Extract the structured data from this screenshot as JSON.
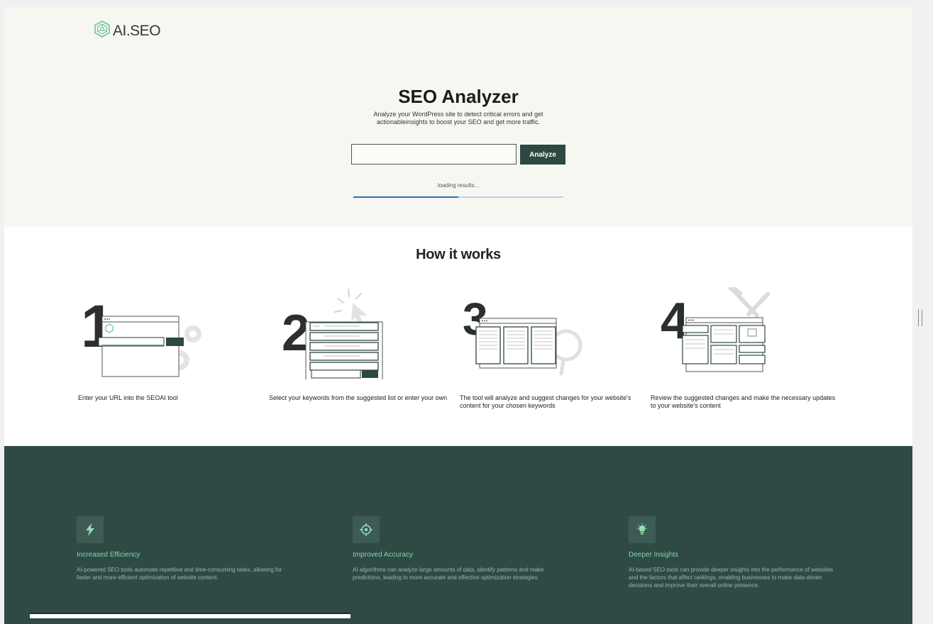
{
  "brand": {
    "name": "AI.SEO",
    "icon": "hexagon-network-icon",
    "accent": "#2d4741"
  },
  "hero": {
    "title": "SEO Analyzer",
    "subtitle": "Analyze your WordPress site to detect critical errors and get actionableinsights to boost your SEO and get more traffic.",
    "input_value": "",
    "input_placeholder": "",
    "button_label": "Analyze",
    "loading_text": "loading results...",
    "progress": 0.5
  },
  "how_it_works": {
    "title": "How it works",
    "steps": [
      {
        "number": "1",
        "text": "Enter your URL into the SEOAI tool"
      },
      {
        "number": "2",
        "text": "Select your keywords from the suggested list or enter your own"
      },
      {
        "number": "3",
        "text": "The tool will analyze and suggest changes for your website's content for your chosen keywords"
      },
      {
        "number": "4",
        "text": "Review the suggested changes and make the necessary updates to your website's content"
      }
    ]
  },
  "features": {
    "background": "#2f4a45",
    "title_color": "#7fd8a8",
    "items": [
      {
        "icon": "lightning-icon",
        "title": "Increased Efficiency",
        "description": "AI-powered SEO tools automate repetitive and time-consuming tasks, allowing for faster and more efficient optimization of website content."
      },
      {
        "icon": "target-icon",
        "title": "Improved Accuracy",
        "description": "AI algorithms can analyze large amounts of data, identify patterns and make predictions, leading to more accurate and effective optimization strategies."
      },
      {
        "icon": "lightbulb-icon",
        "title": "Deeper Insights",
        "description": "AI-based SEO tools can provide deeper insights into the performance of websites and the factors that affect rankings, enabling businesses to make data-driven decisions and improve their overall online presence."
      }
    ]
  }
}
